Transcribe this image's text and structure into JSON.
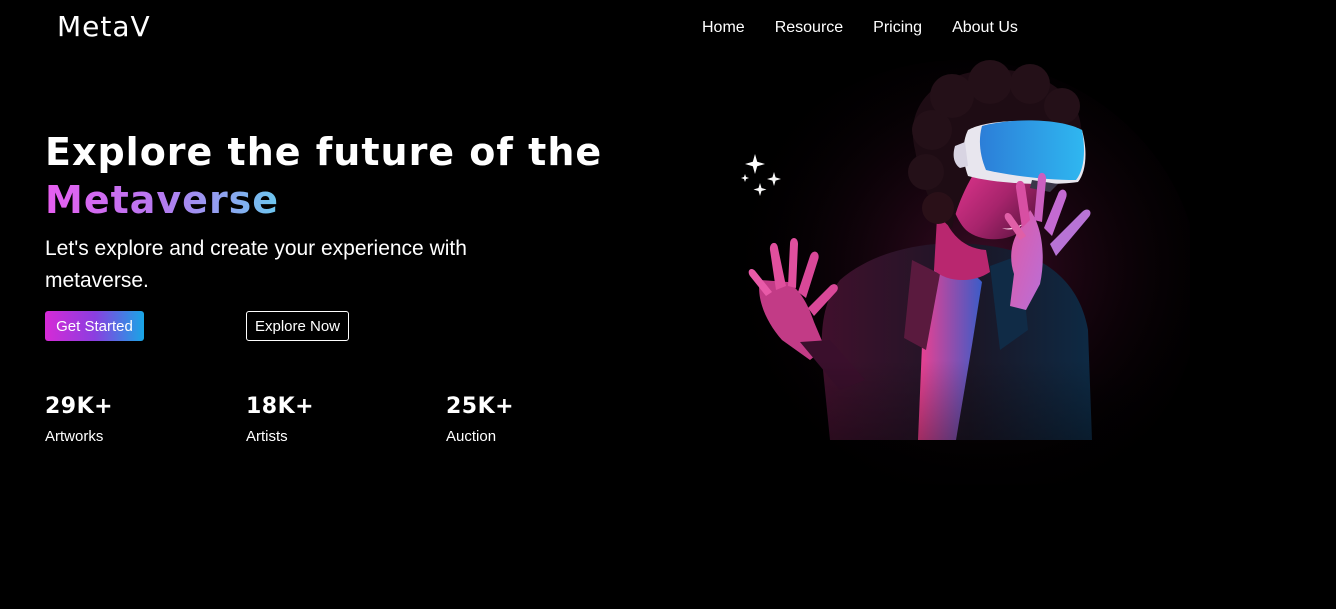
{
  "brand": {
    "logo": "MetaV"
  },
  "nav": {
    "items": [
      {
        "label": "Home"
      },
      {
        "label": "Resource"
      },
      {
        "label": "Pricing"
      },
      {
        "label": "About Us"
      }
    ]
  },
  "hero": {
    "title_line1": "Explore the future of the",
    "title_accent": "Metaverse",
    "subtitle": "Let's explore and create your experience with metaverse.",
    "primary_button": "Get Started",
    "secondary_button": "Explore Now"
  },
  "stats": [
    {
      "value": "29K+",
      "label": "Artworks"
    },
    {
      "value": "18K+",
      "label": "Artists"
    },
    {
      "value": "25K+",
      "label": "Auction"
    }
  ],
  "colors": {
    "background": "#000000",
    "accent_gradient": [
      "#e75ef0",
      "#b57af0",
      "#6cc7ef"
    ],
    "button_gradient": [
      "#d62ad6",
      "#8b3ee0",
      "#18a6e6"
    ]
  },
  "icons": {
    "decoration": "sparkle-icon"
  }
}
